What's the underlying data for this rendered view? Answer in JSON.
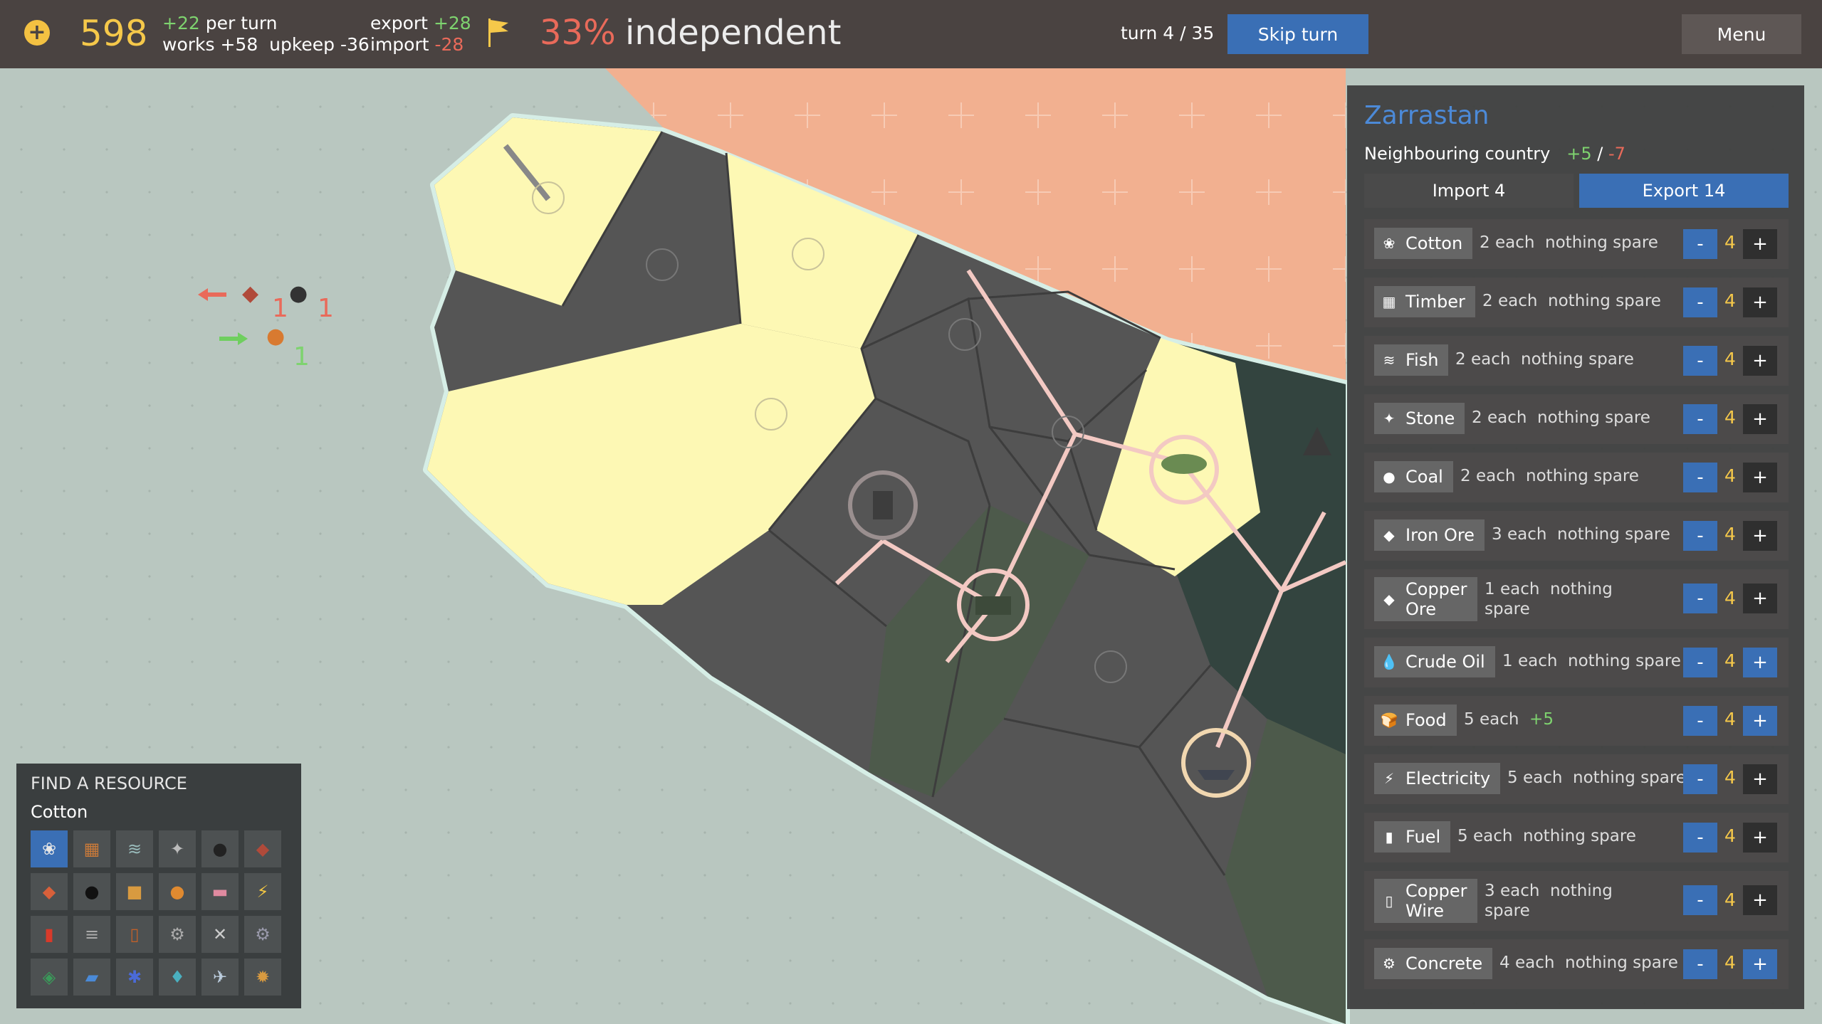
{
  "topbar": {
    "money": "598",
    "per_turn_value": "+22",
    "per_turn_label": "per turn",
    "works_line": "works +58  upkeep -36",
    "export_label": "export",
    "export_value": "+28",
    "import_label": "import",
    "import_value": "-28",
    "independence_pct": "33%",
    "independence_label": "independent",
    "turn": "turn 4 / 35",
    "skip_label": "Skip turn",
    "menu_label": "Menu"
  },
  "flows": {
    "out_a": "1",
    "out_b": "1",
    "in_a": "1"
  },
  "trade_panel": {
    "country": "Zarrastan",
    "relation_label": "Neighbouring country",
    "relation_pos": "+5",
    "relation_sep": "/",
    "relation_neg": "-7",
    "import_tab": "Import 4",
    "export_tab": "Export 14",
    "rows": [
      {
        "name": "Cotton",
        "price": "2 each  nothing spare",
        "qty": "4",
        "icon": "cotton-icon",
        "glyph": "❀"
      },
      {
        "name": "Timber",
        "price": "2 each  nothing spare",
        "qty": "4",
        "icon": "timber-icon",
        "glyph": "▦"
      },
      {
        "name": "Fish",
        "price": "2 each  nothing spare",
        "qty": "4",
        "icon": "fish-icon",
        "glyph": "≋"
      },
      {
        "name": "Stone",
        "price": "2 each  nothing spare",
        "qty": "4",
        "icon": "stone-icon",
        "glyph": "✦"
      },
      {
        "name": "Coal",
        "price": "2 each  nothing spare",
        "qty": "4",
        "icon": "coal-icon",
        "glyph": "●"
      },
      {
        "name": "Iron Ore",
        "price": "3 each  nothing spare",
        "qty": "4",
        "icon": "iron-ore-icon",
        "glyph": "◆"
      },
      {
        "name": "Copper\nOre",
        "price": "1 each  nothing\nspare",
        "qty": "4",
        "icon": "copper-ore-icon",
        "glyph": "◆"
      },
      {
        "name": "Crude Oil",
        "price": "1 each  nothing spare",
        "qty": "4",
        "icon": "crude-oil-icon",
        "glyph": "💧"
      },
      {
        "name": "Food",
        "price": "5 each",
        "price_extra": "+5",
        "qty": "4",
        "icon": "food-icon",
        "glyph": "🍞"
      },
      {
        "name": "Electricity",
        "price": "5 each  nothing spare",
        "qty": "4",
        "icon": "electricity-icon",
        "glyph": "⚡"
      },
      {
        "name": "Fuel",
        "price": "5 each  nothing spare",
        "qty": "4",
        "icon": "fuel-icon",
        "glyph": "▮"
      },
      {
        "name": "Copper\nWire",
        "price": "3 each  nothing\nspare",
        "qty": "4",
        "icon": "copper-wire-icon",
        "glyph": "▯"
      },
      {
        "name": "Concrete",
        "price": "4 each  nothing spare",
        "qty": "4",
        "icon": "concrete-icon",
        "glyph": "⚙"
      }
    ],
    "minus": "-",
    "plus": "+"
  },
  "finder": {
    "title": "FIND A RESOURCE",
    "selected": "Cotton"
  },
  "colors": {
    "accent": "#3a6fb5",
    "gold": "#f5c84a",
    "positive": "#7ed36f",
    "negative": "#e96a5a",
    "neighbour": "#f2b090",
    "owned": "#fdf8b4"
  }
}
